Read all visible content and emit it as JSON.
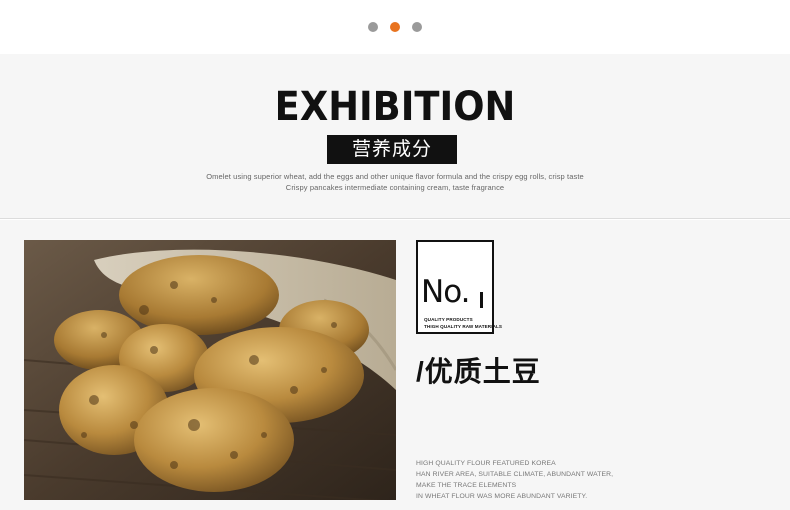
{
  "carousel": {
    "dot_count": 3,
    "active_index": 1,
    "active_color": "#e8731f",
    "inactive_color": "#9a9a9a"
  },
  "header": {
    "title": "EXHIBITION",
    "subtitle_cn": "营养成分",
    "desc_line1": "Omelet using superior wheat, add the eggs and other unique flavor formula and the crispy egg rolls, crisp taste",
    "desc_line2": "Crispy pancakes intermediate containing cream, taste fragrance"
  },
  "product": {
    "badge_text": "No.",
    "badge_sub1": "QUALITY PRODUCTS",
    "badge_sub2": "THIGH QUALITY RAW MATERIALS",
    "name": "/优质土豆",
    "features": [
      "HIGH QUALITY FLOUR FEATURED KOREA",
      "HAN RIVER AREA, SUITABLE CLIMATE, ABUNDANT WATER,",
      "MAKE THE TRACE ELEMENTS",
      "IN WHEAT FLOUR WAS MORE ABUNDANT VARIETY."
    ]
  }
}
